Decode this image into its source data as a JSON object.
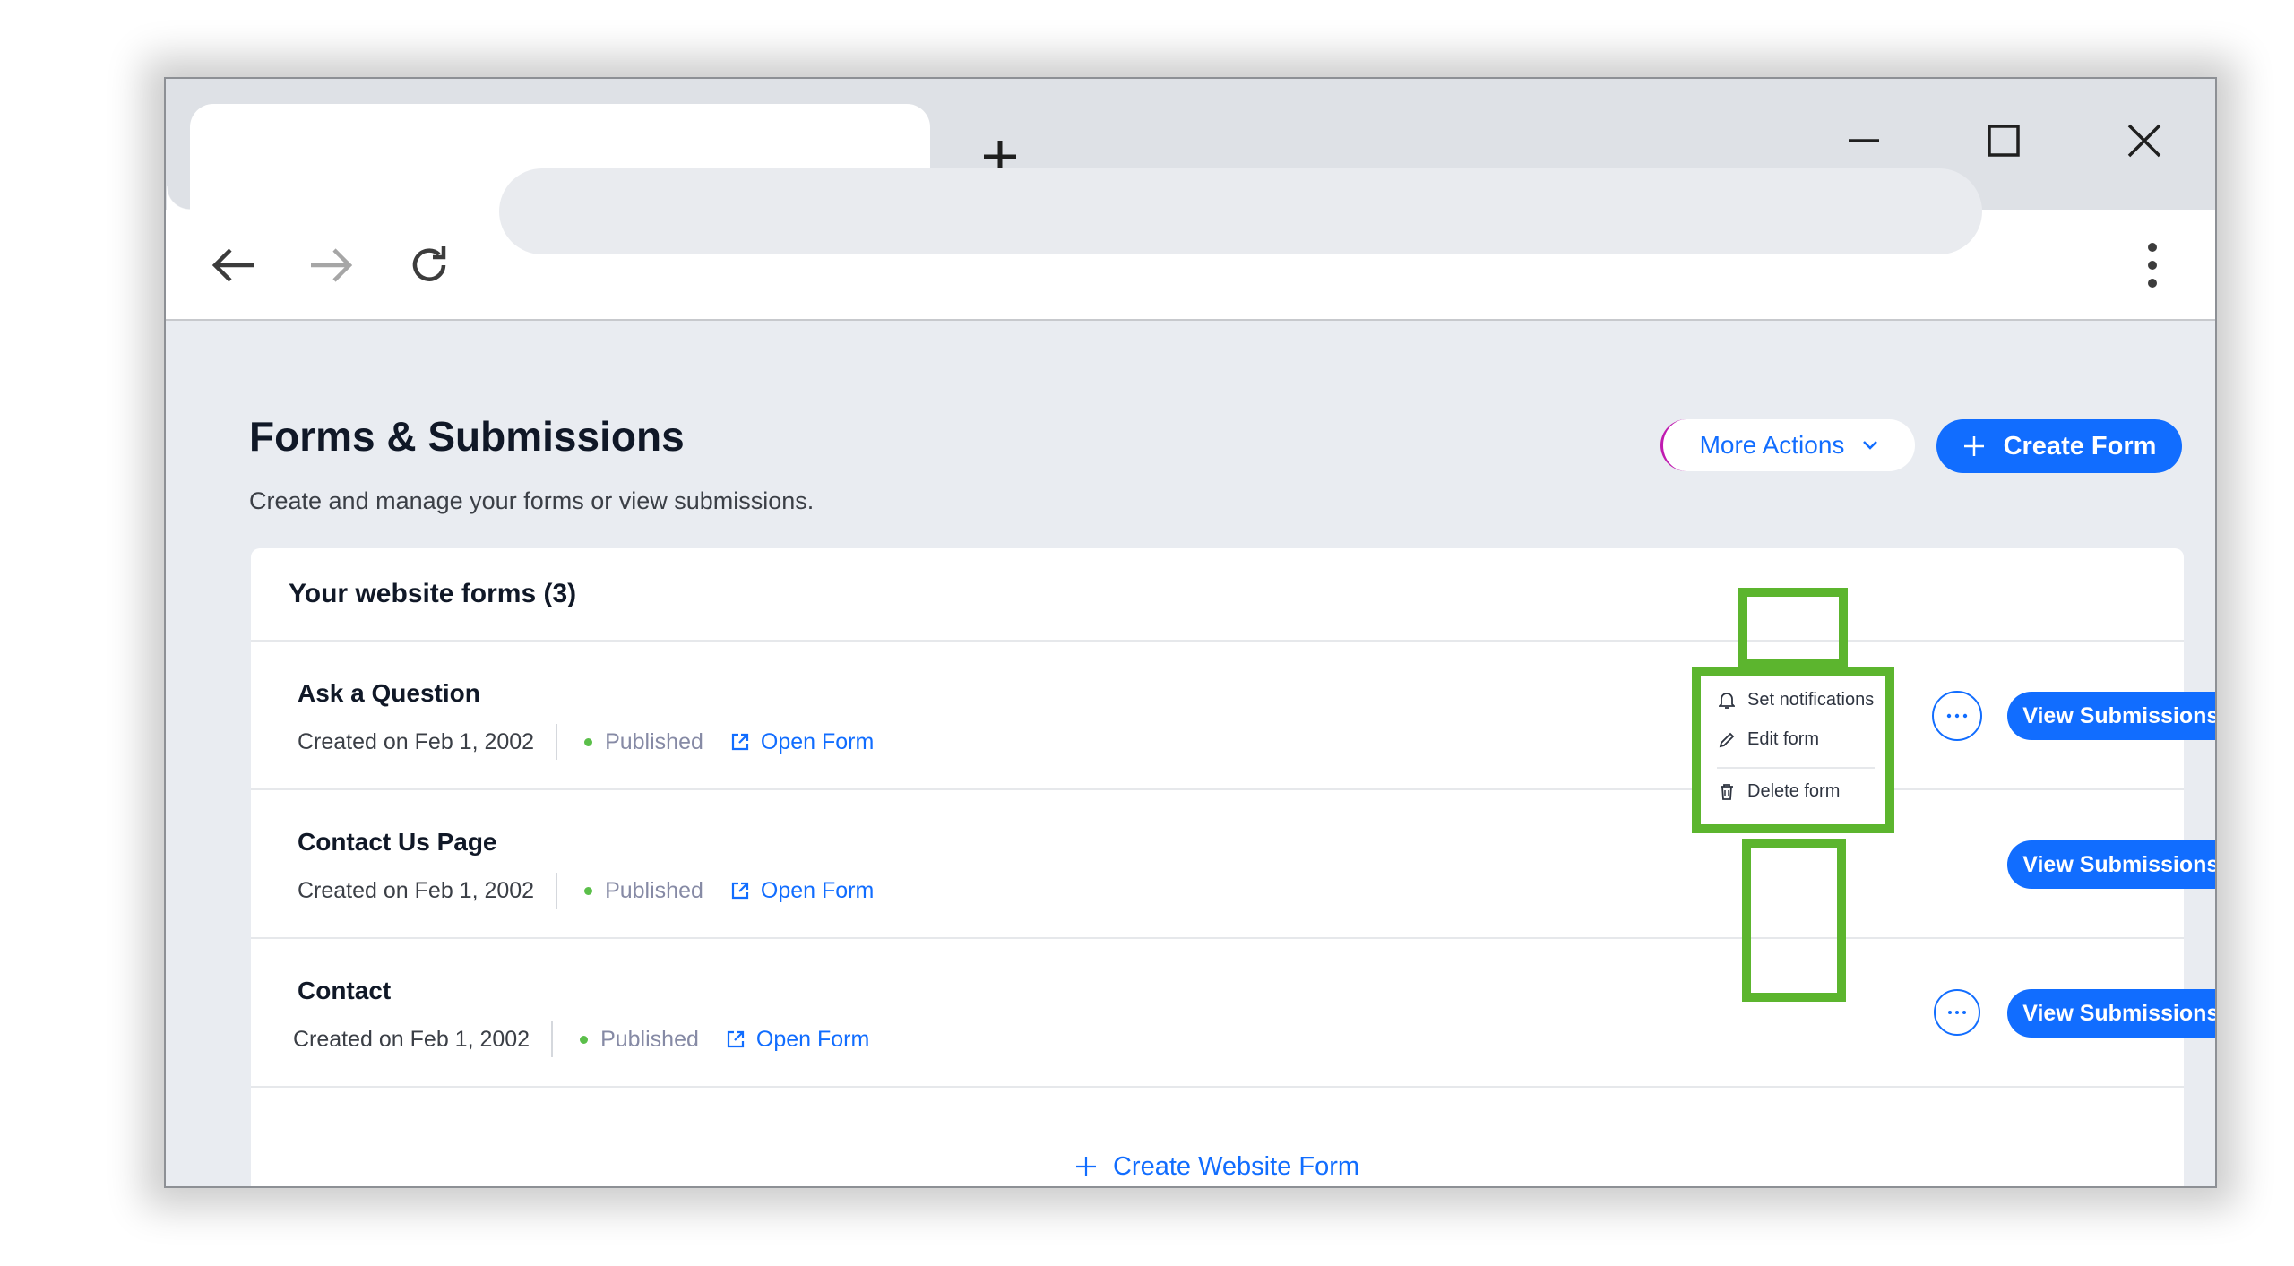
{
  "browser": {
    "new_tab_icon": "plus-icon",
    "window_controls": [
      "minimize-icon",
      "maximize-icon",
      "close-icon"
    ],
    "nav": [
      "back-arrow-icon",
      "forward-arrow-icon",
      "reload-icon"
    ],
    "address_bar_value": "",
    "menu_icon": "kebab-menu-icon"
  },
  "page": {
    "title": "Forms & Submissions",
    "subtitle": "Create and manage your forms or view submissions.",
    "more_actions_label": "More Actions",
    "create_form_label": "Create Form"
  },
  "forms_card": {
    "title": "Your website forms (3)",
    "rows": [
      {
        "name": "Ask a Question",
        "created": "Created on Feb 1, 2002",
        "status": "Published",
        "open_label": "Open Form",
        "view_label": "View Submissions Table"
      },
      {
        "name": "Contact Us Page",
        "created": "Created on Feb 1, 2002",
        "status": "Published",
        "open_label": "Open Form",
        "view_label": "View Submissions Table"
      },
      {
        "name": "Contact",
        "created": "Created on Feb 1, 2002",
        "status": "Published",
        "open_label": "Open Form",
        "view_label": "View Submissions Table"
      }
    ],
    "create_website_form_label": "Create Website Form"
  },
  "row_menu": {
    "items": [
      {
        "label": "Set notifications",
        "icon": "bell-icon"
      },
      {
        "label": "Edit form",
        "icon": "pencil-icon"
      },
      {
        "label": "Delete form",
        "icon": "trash-icon"
      }
    ]
  },
  "colors": {
    "accent": "#116dff",
    "highlight": "#5cb52e",
    "published_dot": "#5bbf4a"
  }
}
